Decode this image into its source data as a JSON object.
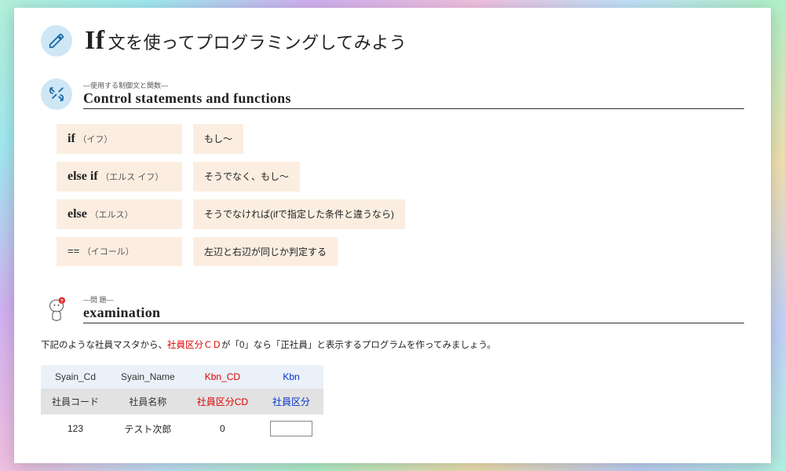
{
  "title": {
    "if": "If",
    "rest": "文を使ってプログラミングしてみよう"
  },
  "section1": {
    "sub": "―使用する制御文と関数―",
    "main": "Control statements and functions",
    "rows": [
      {
        "kw": "if",
        "rd": "（イフ）",
        "desc": "もし～"
      },
      {
        "kw": "else if",
        "rd": "（エルス イフ）",
        "desc": "そうでなく、もし～"
      },
      {
        "kw": "else",
        "rd": "（エルス）",
        "desc": "そうでなければ(ifで指定した条件と違うなら)"
      },
      {
        "kw": "==",
        "rd": "（イコール）",
        "desc": "左辺と右辺が同じか判定する"
      }
    ]
  },
  "section2": {
    "sub": "―問 題―",
    "main": "examination",
    "text_pre": "下記のような社員マスタから、",
    "text_red": "社員区分ＣＤ",
    "text_post": "が「0」なら「正社員」と表示するプログラムを作ってみましょう。"
  },
  "table": {
    "head_en": [
      "Syain_Cd",
      "Syain_Name",
      "Kbn_CD",
      "Kbn"
    ],
    "head_jp": [
      "社員コード",
      "社員名称",
      "社員区分CD",
      "社員区分"
    ],
    "row": {
      "code": "123",
      "name": "テスト次郎",
      "kbncd": "0",
      "kbn": ""
    }
  }
}
